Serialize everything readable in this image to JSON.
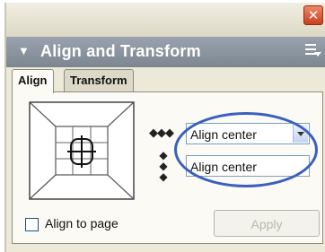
{
  "window": {
    "close_glyph": "✕"
  },
  "panel": {
    "title": "Align and Transform",
    "collapse_glyph": "▼"
  },
  "tabs": [
    {
      "label": "Align",
      "active": true
    },
    {
      "label": "Transform",
      "active": false
    }
  ],
  "align": {
    "horizontal_arrows": "◆◆◆",
    "vertical_arrows": "◆◆◆",
    "horizontal_select": {
      "value": "Align center"
    },
    "vertical_select": {
      "value": "Align center"
    }
  },
  "footer": {
    "align_to_page_label": "Align to page",
    "align_to_page_checked": false,
    "apply_label": "Apply"
  },
  "colors": {
    "highlight": "#3a5fbd",
    "header": "#8a939d"
  }
}
